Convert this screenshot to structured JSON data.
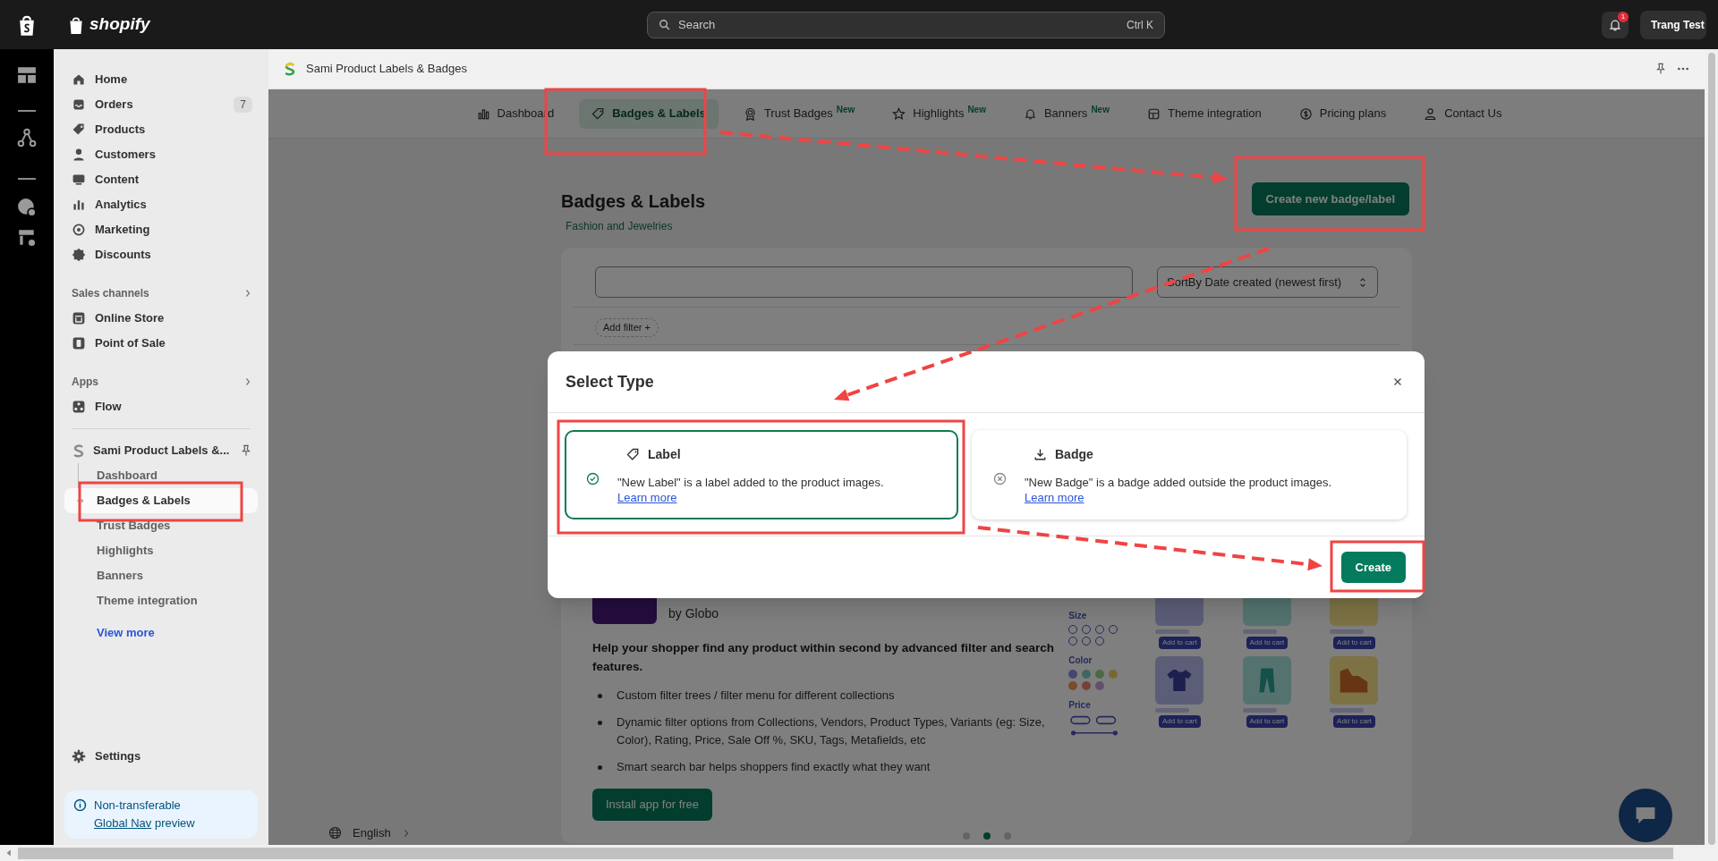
{
  "topbar": {
    "logo": "shopify",
    "search_placeholder": "Search",
    "shortcut": "Ctrl K",
    "notification_count": "1",
    "account": "Trang Test"
  },
  "sidebar": {
    "items": [
      {
        "label": "Home"
      },
      {
        "label": "Orders",
        "count": "7"
      },
      {
        "label": "Products"
      },
      {
        "label": "Customers"
      },
      {
        "label": "Content"
      },
      {
        "label": "Analytics"
      },
      {
        "label": "Marketing"
      },
      {
        "label": "Discounts"
      }
    ],
    "sales_channels": {
      "title": "Sales channels",
      "items": [
        {
          "label": "Online Store"
        },
        {
          "label": "Point of Sale"
        }
      ]
    },
    "apps": {
      "title": "Apps",
      "items": [
        {
          "label": "Flow"
        }
      ]
    },
    "pinned_app": {
      "name": "Sami Product Labels &...",
      "children": [
        {
          "label": "Dashboard",
          "selected": false
        },
        {
          "label": "Badges & Labels",
          "selected": true
        },
        {
          "label": "Trust Badges",
          "selected": false
        },
        {
          "label": "Highlights",
          "selected": false
        },
        {
          "label": "Banners",
          "selected": false
        },
        {
          "label": "Theme integration",
          "selected": false
        }
      ]
    },
    "view_more": "View more",
    "settings": "Settings",
    "notice": {
      "text": "Non-transferable",
      "link": "Global Nav",
      "suffix": "preview"
    }
  },
  "app_header": {
    "title": "Sami Product Labels & Badges"
  },
  "tabs": [
    {
      "label": "Dashboard",
      "selected": false
    },
    {
      "label": "Badges & Labels",
      "selected": true
    },
    {
      "label": "Trust Badges",
      "badge": "New",
      "selected": false
    },
    {
      "label": "Highlights",
      "badge": "New",
      "selected": false
    },
    {
      "label": "Banners",
      "badge": "New",
      "selected": false
    },
    {
      "label": "Theme integration",
      "selected": false
    },
    {
      "label": "Pricing plans",
      "selected": false
    },
    {
      "label": "Contact Us",
      "selected": false
    }
  ],
  "page": {
    "title": "Badges & Labels",
    "subtitle": "Fashion and Jewelries",
    "primary_button": "Create new badge/label",
    "sort": "SortBy Date created (newest first)",
    "add_filter": "Add filter +"
  },
  "promo": {
    "byline": "by Globo",
    "headline": "Help your shopper find any product within second by advanced filter and search features.",
    "bullets": [
      "Custom filter trees / filter menu for different collections",
      "Dynamic filter options from Collections, Vendors, Product Types, Variants (eg: Size, Color), Rating, Price, Sale Off %, SKU, Tags, Metafields, etc",
      "Smart search bar helps shoppers find exactly what they want"
    ],
    "button": "Install app for free",
    "filters": [
      "Size",
      "Color",
      "Price"
    ],
    "products": [
      "Add to cart",
      "Add to cart",
      "Add to cart",
      "Add to cart",
      "Add to cart",
      "Add to cart"
    ],
    "dots": [
      {
        "selected": false
      },
      {
        "selected": true
      },
      {
        "selected": false
      }
    ]
  },
  "language": "English",
  "modal": {
    "title": "Select Type",
    "options": [
      {
        "title": "Label",
        "description": "\"New Label\" is a label added to the product images.",
        "link": "Learn more",
        "selected": true
      },
      {
        "title": "Badge",
        "description": "\"New Badge\" is a badge added outside the product images.",
        "link": "Learn more",
        "selected": false
      }
    ],
    "button": "Create"
  }
}
